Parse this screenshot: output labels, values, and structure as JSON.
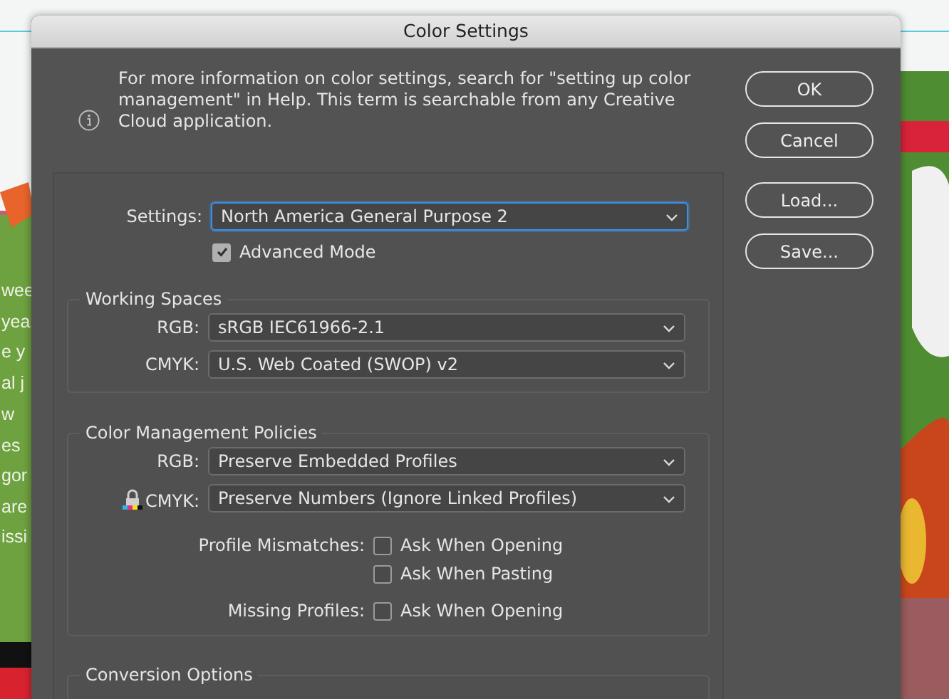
{
  "window": {
    "title": "Color Settings"
  },
  "info": {
    "text": "For more information on color settings, search for \"setting up color management\" in Help. This term is searchable from any Creative Cloud application."
  },
  "buttons": [
    {
      "label": "OK"
    },
    {
      "label": "Cancel"
    },
    {
      "label": "Load..."
    },
    {
      "label": "Save..."
    }
  ],
  "settings": {
    "label": "Settings:",
    "value": "North America General Purpose 2",
    "focused": true
  },
  "advanced_mode": {
    "label": "Advanced Mode",
    "checked": true
  },
  "working_spaces": {
    "title": "Working Spaces",
    "rows": [
      {
        "label": "RGB:",
        "value": "sRGB IEC61966-2.1"
      },
      {
        "label": "CMYK:",
        "value": "U.S. Web Coated (SWOP) v2"
      }
    ]
  },
  "policies": {
    "title": "Color Management Policies",
    "rows": [
      {
        "label": "RGB:",
        "value": "Preserve Embedded Profiles",
        "locked": false
      },
      {
        "label": "CMYK:",
        "value": "Preserve Numbers (Ignore Linked Profiles)",
        "locked": true
      }
    ],
    "options": [
      {
        "label": "Profile Mismatches:",
        "text": "Ask When Opening",
        "checked": false
      },
      {
        "text": "Ask When Pasting",
        "checked": false
      },
      {
        "label": "Missing Profiles:",
        "text": "Ask When Opening",
        "checked": false
      }
    ]
  },
  "conversion": {
    "title": "Conversion Options"
  },
  "document": {
    "text_fragments": [
      "wee",
      "yea",
      "e y",
      "al j",
      "w",
      "es",
      "gor",
      "are",
      "issi"
    ]
  }
}
